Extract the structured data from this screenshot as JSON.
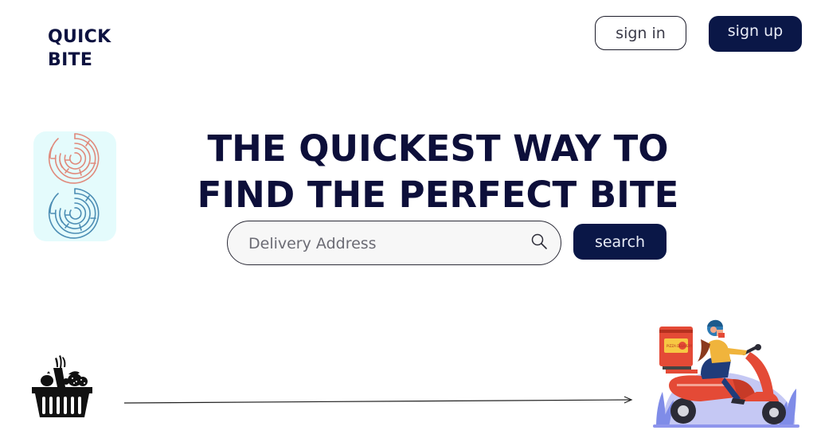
{
  "brand": {
    "line1": "QUICK",
    "line2": "BITE"
  },
  "header": {
    "signin_label": "sign in",
    "signup_label": "sign up"
  },
  "hero": {
    "line1": "THE QUICKEST WAY TO",
    "line2": "FIND THE PERFECT BITE"
  },
  "search": {
    "placeholder": "Delivery Address",
    "value": "",
    "button_label": "search"
  },
  "illustrations": {
    "maze_icon": "maze-icon",
    "basket_icon": "grocery-basket-icon",
    "arrow_icon": "arrow-right-icon",
    "scooter_icon": "delivery-scooter-icon",
    "pizza_box_text": "PIZZA DELIVERY"
  },
  "colors": {
    "primary": "#0a1747",
    "heading": "#0d0f3a",
    "maze_card_bg": "#e4fbfc",
    "maze_red": "#e08a7c",
    "maze_blue": "#4c8db4",
    "scooter_red": "#e44a36"
  }
}
